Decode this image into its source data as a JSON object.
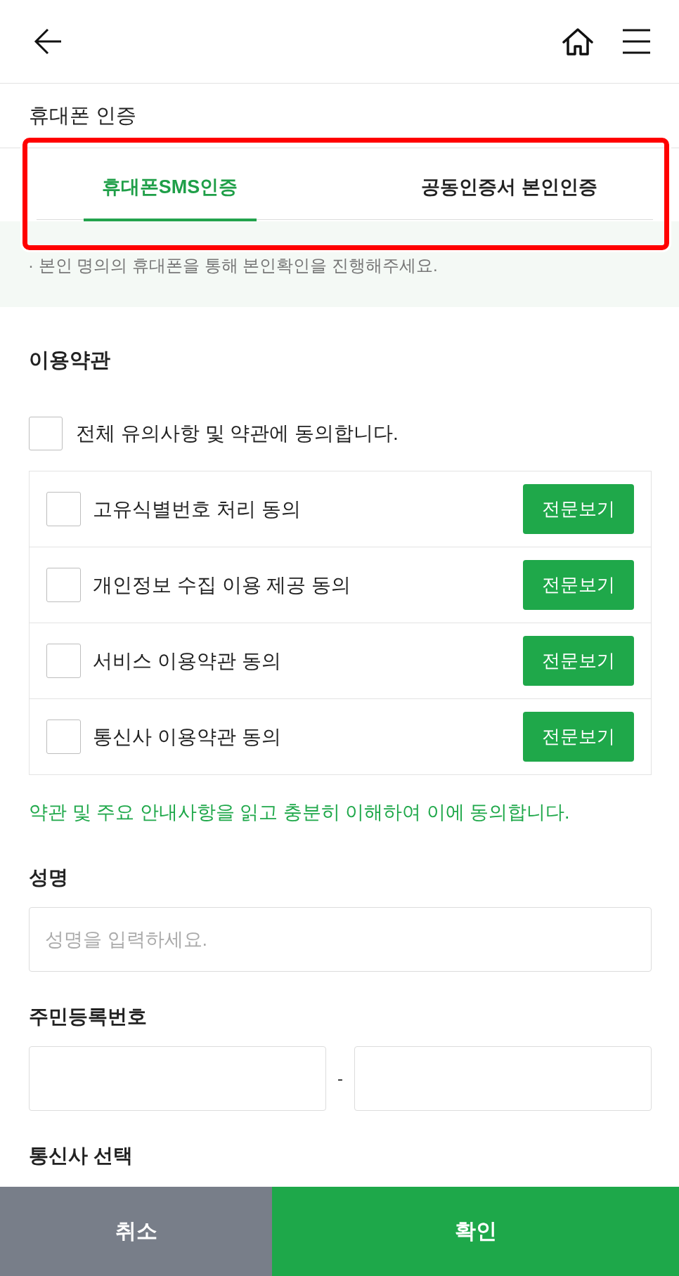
{
  "page_title": "휴대폰 인증",
  "tab_bar": {
    "highlighted": true,
    "tabs": [
      {
        "label": "휴대폰SMS인증",
        "selected": true
      },
      {
        "label": "공동인증서 본인인증",
        "selected": false
      }
    ]
  },
  "notice": "· 본인 명의의 휴대폰을 통해 본인확인을 진행해주세요.",
  "terms": {
    "heading": "이용약관",
    "agree_all": {
      "label": "전체 유의사항 및 약관에 동의합니다.",
      "checked": false
    },
    "items": [
      {
        "label": "고유식별번호 처리 동의",
        "checked": false,
        "button": "전문보기"
      },
      {
        "label": "개인정보 수집 이용 제공 동의",
        "checked": false,
        "button": "전문보기"
      },
      {
        "label": "서비스 이용약관 동의",
        "checked": false,
        "button": "전문보기"
      },
      {
        "label": "통신사 이용약관 동의",
        "checked": false,
        "button": "전문보기"
      }
    ],
    "confirmation": "약관 및 주요 안내사항을 읽고 충분히 이해하여 이에 동의합니다."
  },
  "form": {
    "fields": [
      {
        "kind": "text",
        "label": "성명",
        "placeholder": "성명을 입력하세요."
      },
      {
        "kind": "split",
        "label": "주민등록번호",
        "separator": "-"
      },
      {
        "kind": "select",
        "label": "통신사 선택"
      }
    ]
  },
  "footer_buttons": [
    {
      "kind": "cancel",
      "label": "취소"
    },
    {
      "kind": "primary",
      "label": "확인"
    }
  ]
}
